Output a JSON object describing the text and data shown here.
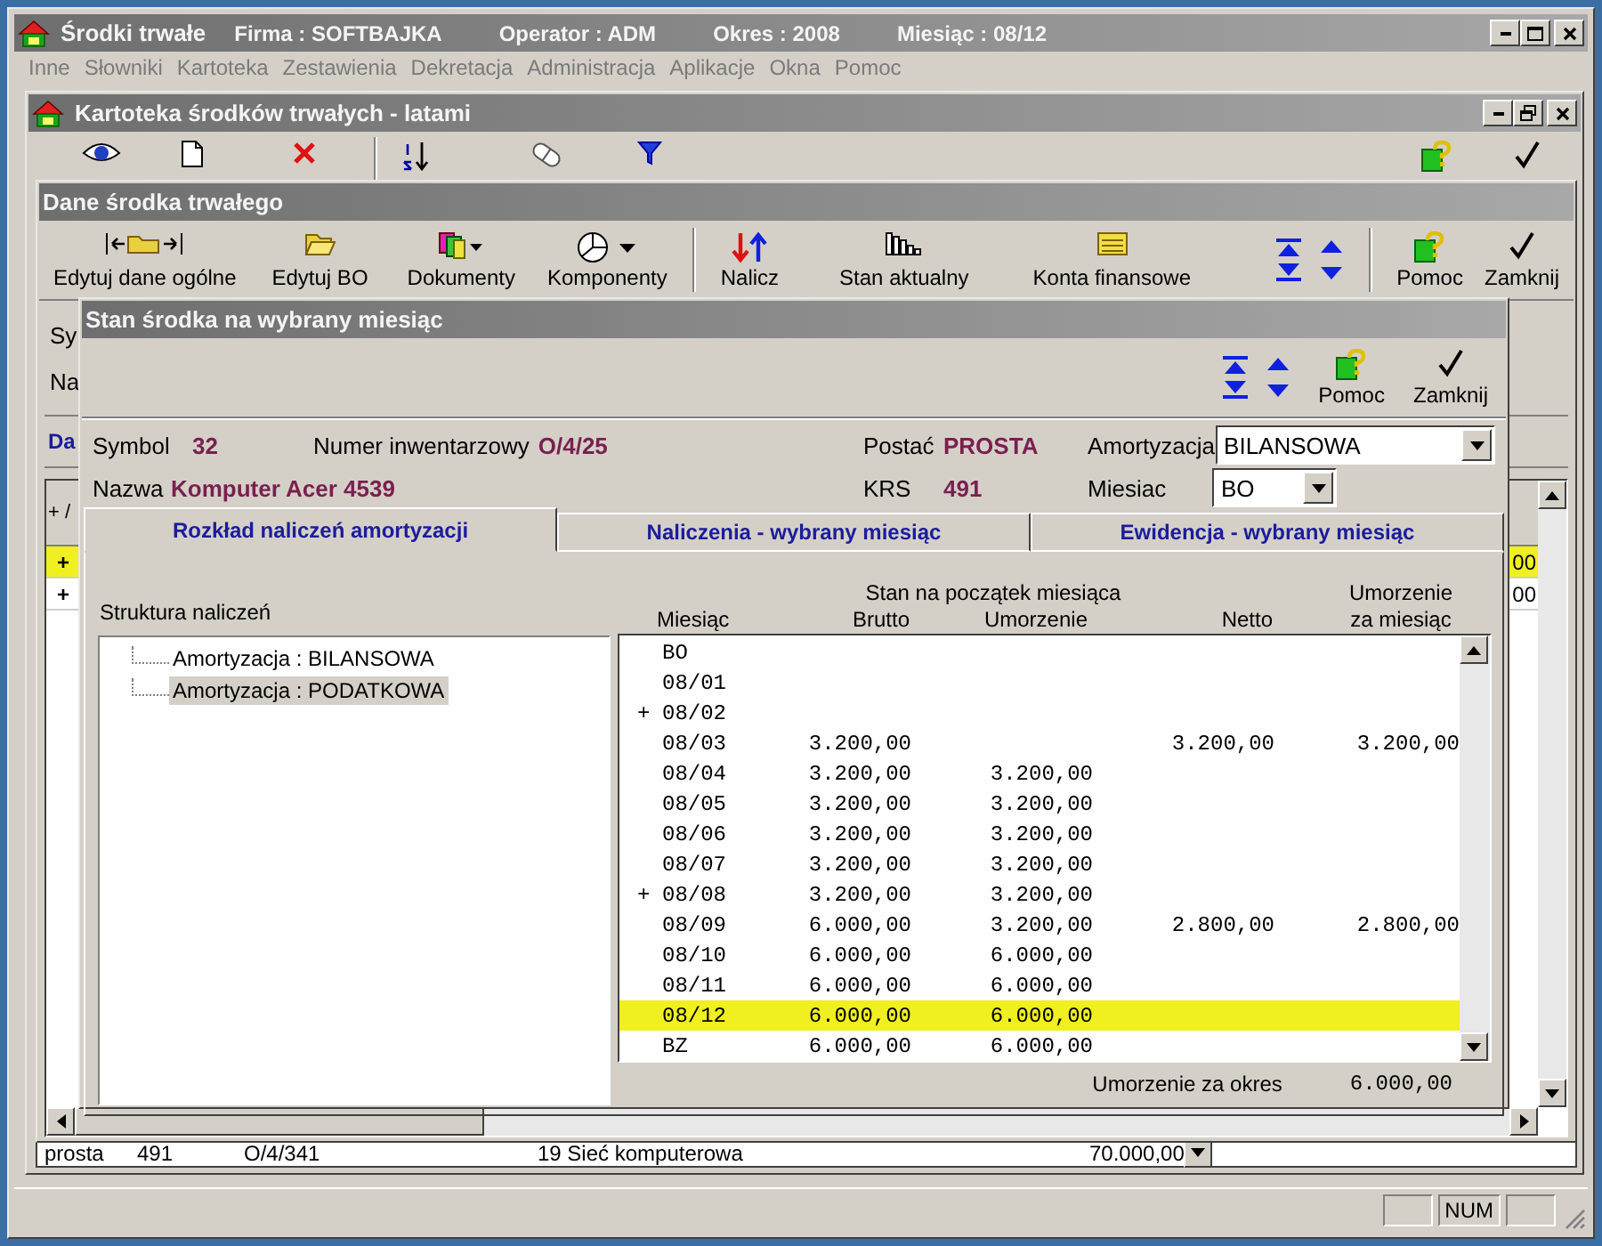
{
  "app": {
    "title": "Środki trwałe",
    "info": [
      "Firma : SOFTBAJKA",
      "Operator : ADM",
      "Okres : 2008",
      "Miesiąc : 08/12"
    ]
  },
  "menu": [
    "Inne",
    "Słowniki",
    "Kartoteka",
    "Zestawienia",
    "Dekretacja",
    "Administracja",
    "Aplikacje",
    "Okna",
    "Pomoc"
  ],
  "register_window": {
    "title": "Kartoteka środków trwałych - latami",
    "list_row": [
      "prosta",
      "491",
      "O/4/341",
      "19 Sieć komputerowa",
      "70.000,00"
    ]
  },
  "asset_window": {
    "title": "Dane środka trwałego",
    "toolbar": [
      "Edytuj dane ogólne",
      "Edytuj BO",
      "Dokumenty",
      "Komponenty",
      "Nalicz",
      "Stan aktualny",
      "Konta finansowe"
    ],
    "side_buttons": [
      "Pomoc",
      "Zamknij"
    ],
    "background_labels": [
      "Sy",
      "Na"
    ],
    "background_tab": "Da",
    "grid_header": "+ /",
    "grid_rows": [
      {
        "marker": "+",
        "value": "00",
        "selected": true
      },
      {
        "marker": "+",
        "value": "00",
        "selected": false
      }
    ]
  },
  "month_dialog": {
    "title": "Stan środka na wybrany miesiąc",
    "side_buttons": [
      "Pomoc",
      "Zamknij"
    ],
    "fields": {
      "symbol": {
        "label": "Symbol",
        "value": "32"
      },
      "inventory": {
        "label": "Numer inwentarzowy",
        "value": "O/4/25"
      },
      "name": {
        "label": "Nazwa",
        "value": "Komputer Acer 4539"
      },
      "form": {
        "label": "Postać",
        "value": "PROSTA"
      },
      "krs": {
        "label": "KRS",
        "value": "491"
      }
    },
    "depreciation": {
      "label": "Amortyzacja",
      "value": "BILANSOWA"
    },
    "month": {
      "label": "Miesiac",
      "value": "BO"
    },
    "tabs": [
      {
        "label": "Rozkład naliczeń amortyzacji",
        "selected": true
      },
      {
        "label": "Naliczenia - wybrany miesiąc",
        "selected": false
      },
      {
        "label": "Ewidencja - wybrany miesiąc",
        "selected": false
      }
    ],
    "tree": {
      "title": "Struktura naliczeń",
      "items": [
        {
          "label": "Amortyzacja : BILANSOWA",
          "selected": false
        },
        {
          "label": "Amortyzacja : PODATKOWA",
          "selected": true
        }
      ]
    },
    "table": {
      "group_header": "Stan na początek miesiąca",
      "columns": [
        "Miesiąc",
        "Brutto",
        "Umorzenie",
        "Netto",
        "Umorzenie za miesiąc"
      ],
      "rows": [
        {
          "expand": "",
          "month": "BO",
          "brutto": "",
          "umorzenie": "",
          "netto": "",
          "za_miesiac": "",
          "selected": false
        },
        {
          "expand": "",
          "month": "08/01",
          "brutto": "",
          "umorzenie": "",
          "netto": "",
          "za_miesiac": "",
          "selected": false
        },
        {
          "expand": "+",
          "month": "08/02",
          "brutto": "",
          "umorzenie": "",
          "netto": "",
          "za_miesiac": "",
          "selected": false
        },
        {
          "expand": "",
          "month": "08/03",
          "brutto": "3.200,00",
          "umorzenie": "",
          "netto": "3.200,00",
          "za_miesiac": "3.200,00",
          "selected": false
        },
        {
          "expand": "",
          "month": "08/04",
          "brutto": "3.200,00",
          "umorzenie": "3.200,00",
          "netto": "",
          "za_miesiac": "",
          "selected": false
        },
        {
          "expand": "",
          "month": "08/05",
          "brutto": "3.200,00",
          "umorzenie": "3.200,00",
          "netto": "",
          "za_miesiac": "",
          "selected": false
        },
        {
          "expand": "",
          "month": "08/06",
          "brutto": "3.200,00",
          "umorzenie": "3.200,00",
          "netto": "",
          "za_miesiac": "",
          "selected": false
        },
        {
          "expand": "",
          "month": "08/07",
          "brutto": "3.200,00",
          "umorzenie": "3.200,00",
          "netto": "",
          "za_miesiac": "",
          "selected": false
        },
        {
          "expand": "+",
          "month": "08/08",
          "brutto": "3.200,00",
          "umorzenie": "3.200,00",
          "netto": "",
          "za_miesiac": "",
          "selected": false
        },
        {
          "expand": "",
          "month": "08/09",
          "brutto": "6.000,00",
          "umorzenie": "3.200,00",
          "netto": "2.800,00",
          "za_miesiac": "2.800,00",
          "selected": false
        },
        {
          "expand": "",
          "month": "08/10",
          "brutto": "6.000,00",
          "umorzenie": "6.000,00",
          "netto": "",
          "za_miesiac": "",
          "selected": false
        },
        {
          "expand": "",
          "month": "08/11",
          "brutto": "6.000,00",
          "umorzenie": "6.000,00",
          "netto": "",
          "za_miesiac": "",
          "selected": false
        },
        {
          "expand": "",
          "month": "08/12",
          "brutto": "6.000,00",
          "umorzenie": "6.000,00",
          "netto": "",
          "za_miesiac": "",
          "selected": true
        },
        {
          "expand": "",
          "month": "BZ",
          "brutto": "6.000,00",
          "umorzenie": "6.000,00",
          "netto": "",
          "za_miesiac": "",
          "selected": false
        }
      ],
      "total_label": "Umorzenie za okres",
      "total_value": "6.000,00"
    }
  },
  "status_bar": {
    "num": "NUM"
  }
}
